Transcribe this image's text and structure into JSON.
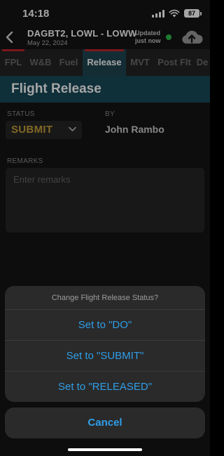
{
  "status_bar": {
    "time": "14:18",
    "battery": "87"
  },
  "header": {
    "flight": "DAGBT2, LOWL - LOWW",
    "date": "May 22, 2024",
    "updated_line1": "Updated",
    "updated_line2": "just now"
  },
  "tabs": [
    {
      "label": "FPL",
      "flag_red": true,
      "active": false
    },
    {
      "label": "W&B",
      "flag_red": false,
      "active": false
    },
    {
      "label": "Fuel",
      "flag_red": false,
      "active": false
    },
    {
      "label": "Release",
      "flag_red": true,
      "active": true
    },
    {
      "label": "MVT",
      "flag_red": false,
      "active": false
    },
    {
      "label": "Post Flt",
      "flag_red": false,
      "active": false
    },
    {
      "label": "De",
      "flag_red": false,
      "active": false
    }
  ],
  "section": {
    "title": "Flight Release"
  },
  "form": {
    "status_label": "STATUS",
    "status_value": "SUBMIT",
    "by_label": "BY",
    "by_value": "John Rambo",
    "remarks_label": "REMARKS",
    "remarks_placeholder": "Enter remarks",
    "remarks_value": ""
  },
  "action_sheet": {
    "title": "Change Flight Release Status?",
    "options": [
      "Set to \"DO\"",
      "Set to \"SUBMIT\"",
      "Set to \"RELEASED\""
    ],
    "cancel": "Cancel"
  },
  "colors": {
    "accent_blue": "#2f9ee8",
    "status_gold": "#c7a13a",
    "tab_flag_red": "#c0242c",
    "online_green": "#2fbf4a",
    "section_teal": "#174958"
  },
  "icons": [
    "back-chevron-icon",
    "cloud-upload-icon",
    "signal-icon",
    "wifi-icon",
    "battery-icon",
    "chevron-down-icon"
  ]
}
